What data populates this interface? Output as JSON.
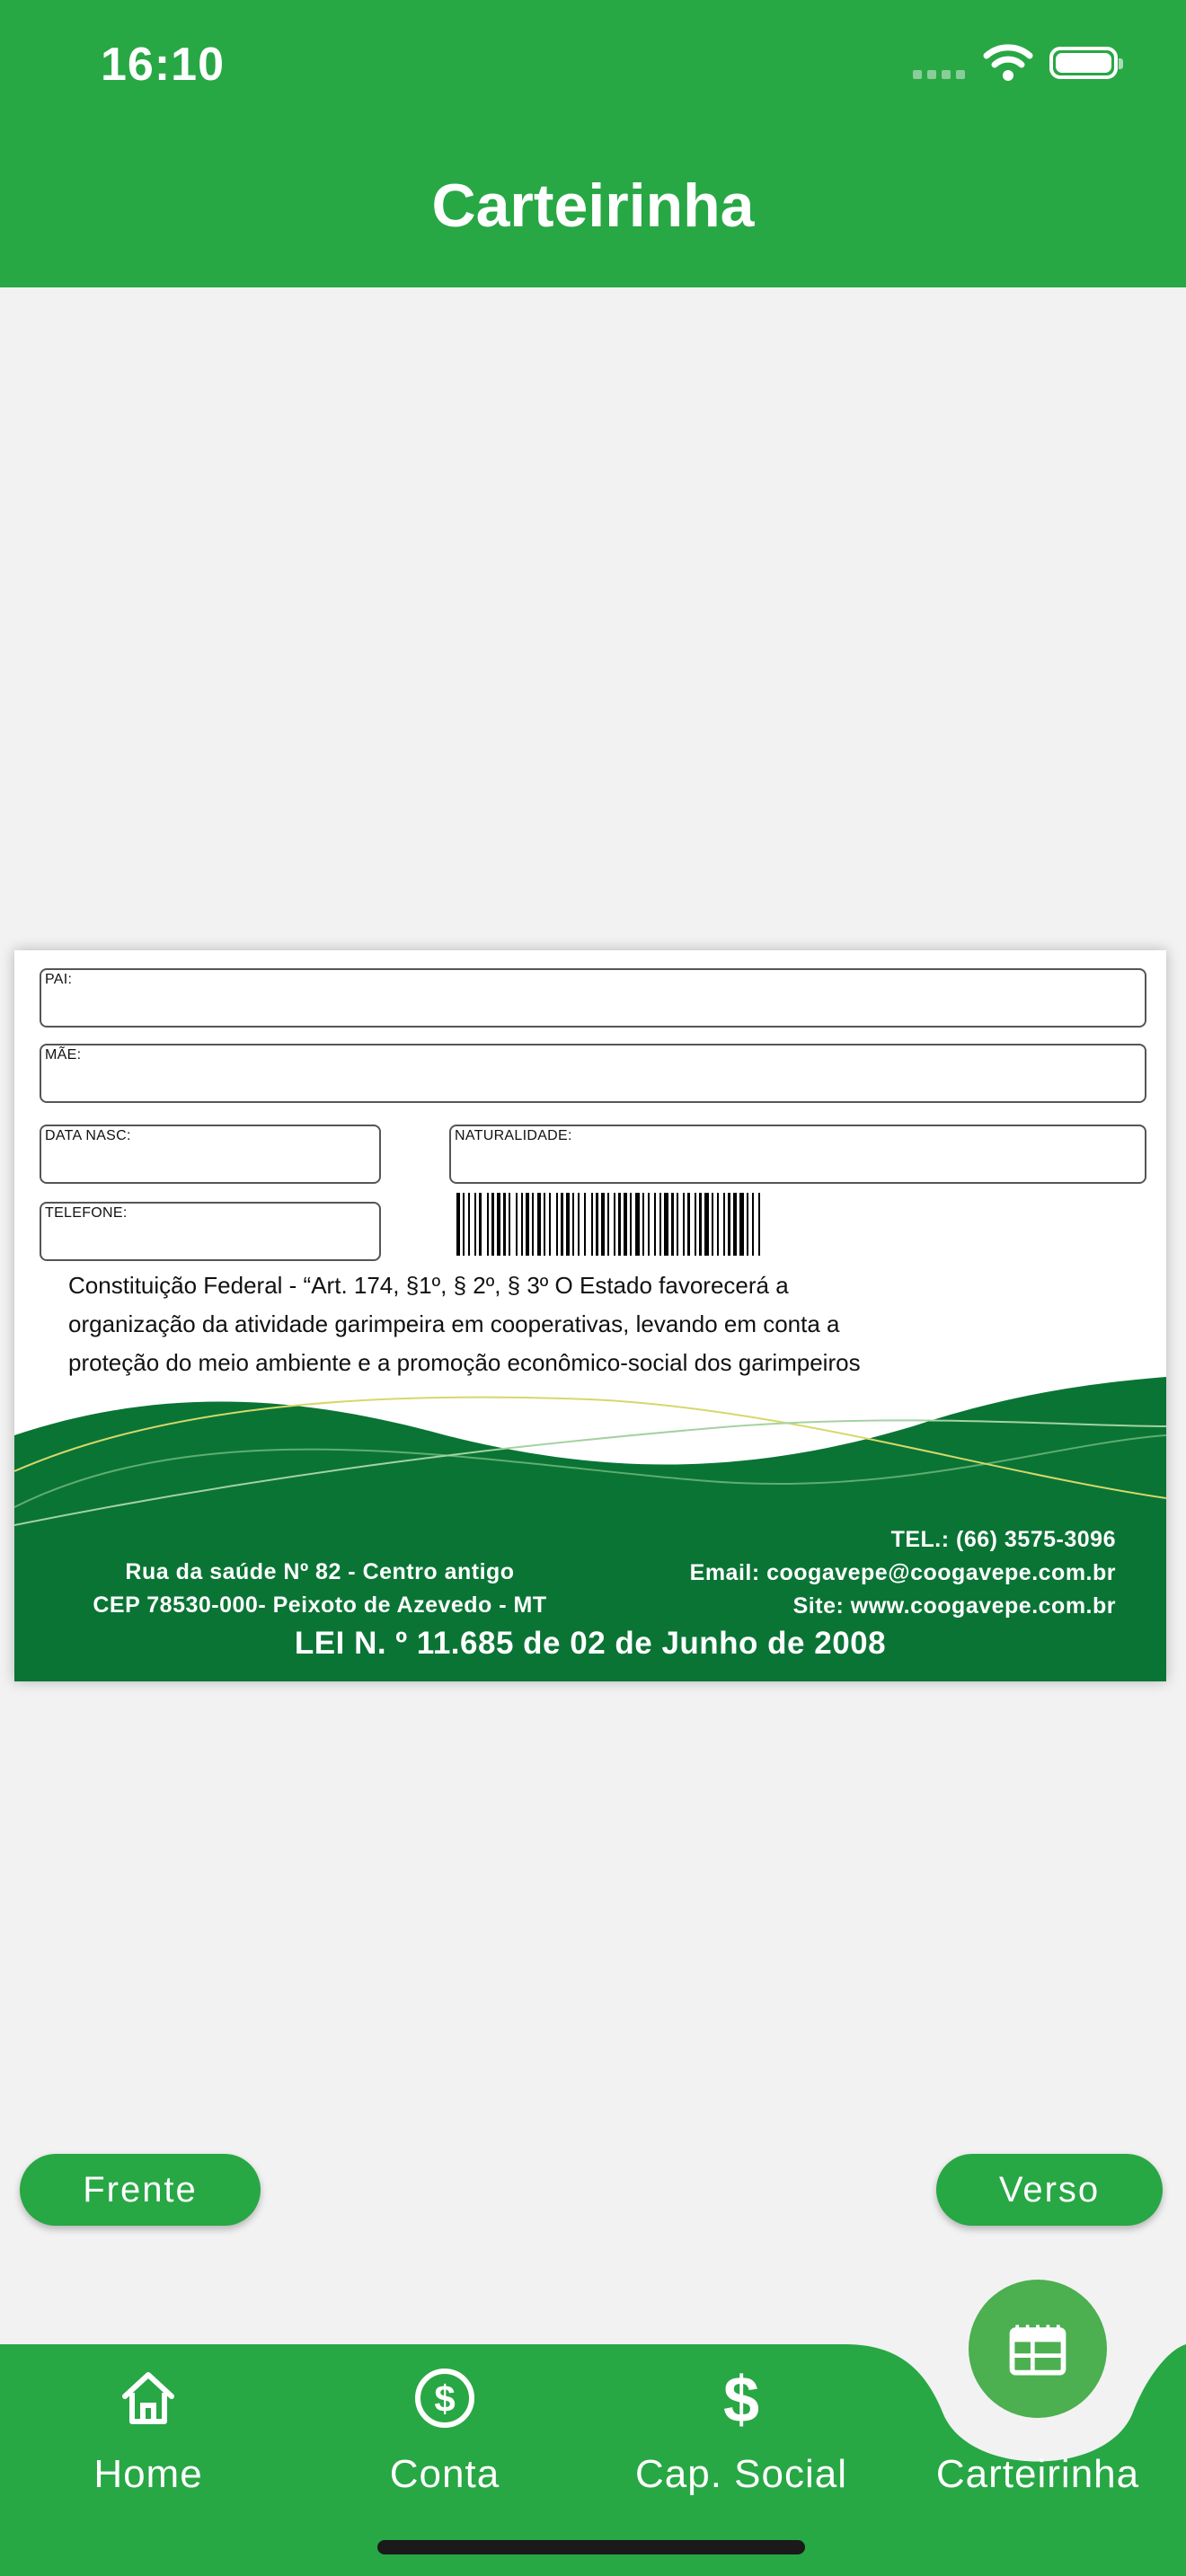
{
  "status": {
    "time": "16:10"
  },
  "header": {
    "title": "Carteirinha"
  },
  "card": {
    "fields": {
      "pai": "PAI:",
      "mae": "MÃE:",
      "data_nasc": "DATA NASC:",
      "naturalidade": "NATURALIDADE:",
      "telefone": "TELEFONE:"
    },
    "legal_lines": [
      "Constituição Federal - “Art. 174, §1º, § 2º, § 3º O Estado favorecerá a",
      "organização da atividade garimpeira em cooperativas, levando em conta a",
      "proteção do meio ambiente e a promoção econômico-social dos garimpeiros"
    ],
    "address_lines": [
      "Rua da saúde Nº 82 - Centro antigo",
      "CEP 78530-000- Peixoto de Azevedo - MT"
    ],
    "contact_lines": [
      "TEL.: (66) 3575-3096",
      "Email: coogavepe@coogavepe.com.br",
      "Site: www.coogavepe.com.br"
    ],
    "law": "LEI N. º 11.685 de 02 de Junho de 2008"
  },
  "buttons": {
    "front": "Frente",
    "back": "Verso"
  },
  "tabs": [
    {
      "label": "Home",
      "icon": "home-icon"
    },
    {
      "label": "Conta",
      "icon": "dollar-circle-icon"
    },
    {
      "label": "Cap. Social",
      "icon": "dollar-icon"
    },
    {
      "label": "Carteirinha",
      "icon": "id-card-icon"
    }
  ],
  "colors": {
    "primary": "#28a745",
    "card_green": "#0a7435",
    "fab": "#4caf50"
  }
}
